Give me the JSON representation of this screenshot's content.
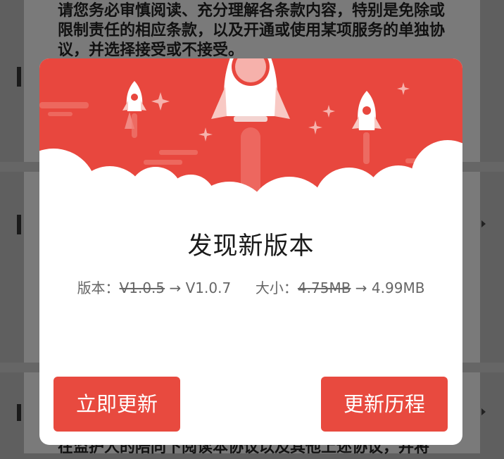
{
  "background": {
    "text": "请您务必审慎阅读、充分理解各条款内容，特别是免除或限制责任的相应条款，以及开通或使用某项服务的单独协议，并选择接受或不接受。",
    "bottom_text": "在监护人的陪同下阅读本协议以及其他上述协议，并将"
  },
  "dialog": {
    "title": "发现新版本",
    "version_label": "版本：",
    "old_version": "V1.0.5",
    "arrow": "→",
    "new_version": "V1.0.7",
    "size_label": "大小：",
    "old_size": "4.75MB",
    "new_size": "4.99MB",
    "update_button": "立即更新",
    "history_button": "更新历程"
  },
  "colors": {
    "accent": "#e84a3f",
    "hero_red": "#e8473e"
  },
  "icons": [
    "rocket-icon",
    "sparkle-icon",
    "cloud-icon"
  ]
}
